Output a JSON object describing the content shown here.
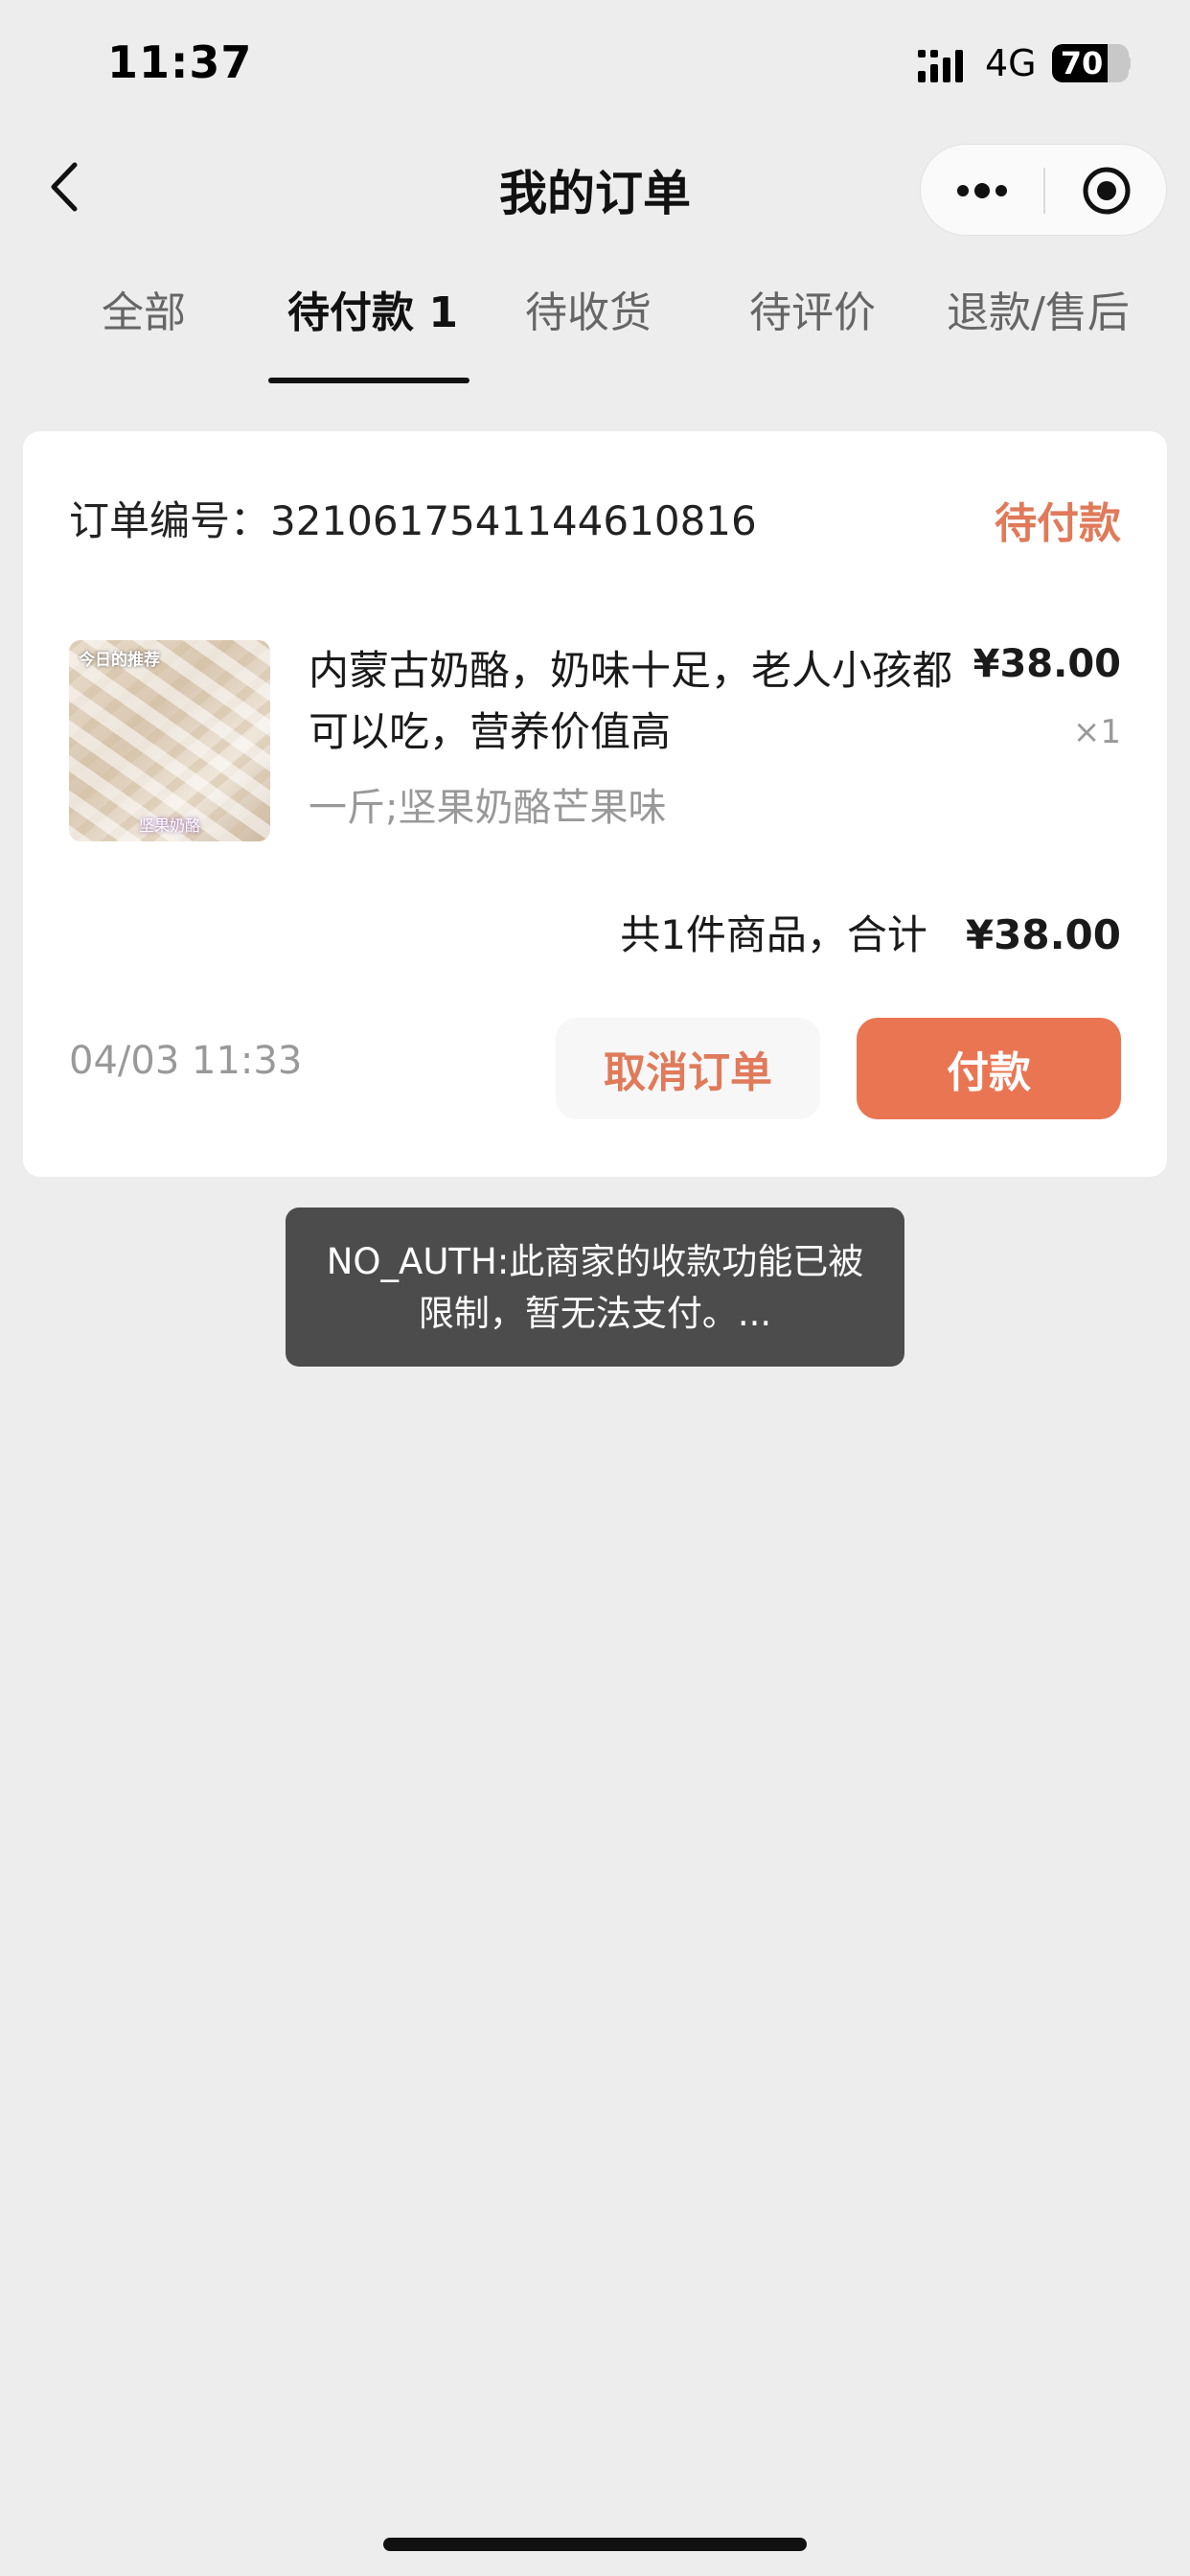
{
  "status_bar": {
    "time": "11:37",
    "network": "4G",
    "battery": "70"
  },
  "nav": {
    "title": "我的订单",
    "back_icon": "chevron-left-icon",
    "more_icon": "more-dots-icon",
    "close_icon": "target-circle-icon"
  },
  "tabs": [
    {
      "label": "全部",
      "active": false
    },
    {
      "label": "待付款 1",
      "active": true
    },
    {
      "label": "待收货",
      "active": false
    },
    {
      "label": "待评价",
      "active": false
    },
    {
      "label": "退款/售后",
      "active": false
    }
  ],
  "order": {
    "number_label": "订单编号：",
    "number": "3210617541144610816",
    "status": "待付款",
    "product": {
      "thumb_badge": "今日的推荐",
      "thumb_caption": "坚果奶酪",
      "title": "内蒙古奶酪，奶味十足，老人小孩都可以吃，营养价值高",
      "spec": "一斤;坚果奶酪芒果味",
      "price": "¥38.00",
      "quantity": "×1"
    },
    "summary_text": "共1件商品，合计",
    "total": "¥38.00",
    "time": "04/03 11:33",
    "cancel_label": "取消订单",
    "pay_label": "付款"
  },
  "toast": {
    "message": "NO_AUTH:此商家的收款功能已被限制，暂无法支付。..."
  },
  "colors": {
    "accent": "#e07a5a",
    "pay_button": "#ea7553",
    "background": "#ededed",
    "toast_bg": "#4c4c4c"
  }
}
